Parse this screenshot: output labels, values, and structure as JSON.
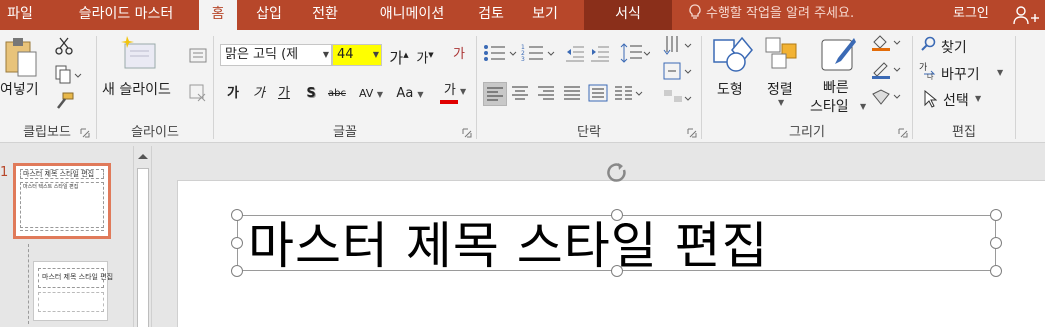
{
  "tabs": {
    "file": "파일",
    "slide_master": "슬라이드 마스터",
    "home": "홈",
    "insert": "삽입",
    "transitions": "전환",
    "animations": "애니메이션",
    "review": "검토",
    "view": "보기",
    "format": "서식"
  },
  "tellme": {
    "placeholder": "수행할 작업을 알려 주세요."
  },
  "account": {
    "login": "로그인"
  },
  "ribbon": {
    "clipboard": {
      "paste": "여넣기",
      "label": "클립보드"
    },
    "slides": {
      "new_slide": "새 슬라이드",
      "label": "슬라이드"
    },
    "font": {
      "font_name": "맑은 고딕 (제",
      "font_size": "44",
      "grow": "가",
      "shrink": "가",
      "clear": "가",
      "bold": "가",
      "italic": "가",
      "underline": "가",
      "shadow": "S",
      "strike": "abc",
      "spacing": "AV",
      "case": "Aa",
      "color": "가",
      "label": "글꼴"
    },
    "paragraph": {
      "label": "단락"
    },
    "drawing": {
      "shapes": "도형",
      "arrange": "정렬",
      "quick_styles_1": "빠른",
      "quick_styles_2": "스타일",
      "label": "그리기"
    },
    "editing": {
      "find": "찾기",
      "replace": "바꾸기",
      "select": "선택",
      "label": "편집"
    }
  },
  "thumbnails": {
    "slide1_number": "1",
    "slide1_title": "마스터 제목 스타일 편집",
    "slide1_sub": "마스터 텍스트 스타일 편집",
    "slide2_title": "마스터 제목 스타일 편집"
  },
  "slide": {
    "title": "마스터 제목 스타일 편집"
  },
  "colors": {
    "accent": "#b7472a",
    "highlight": "#ffff00",
    "font_color_bar": "#e00000",
    "thumb_selected": "#e07a5a"
  }
}
